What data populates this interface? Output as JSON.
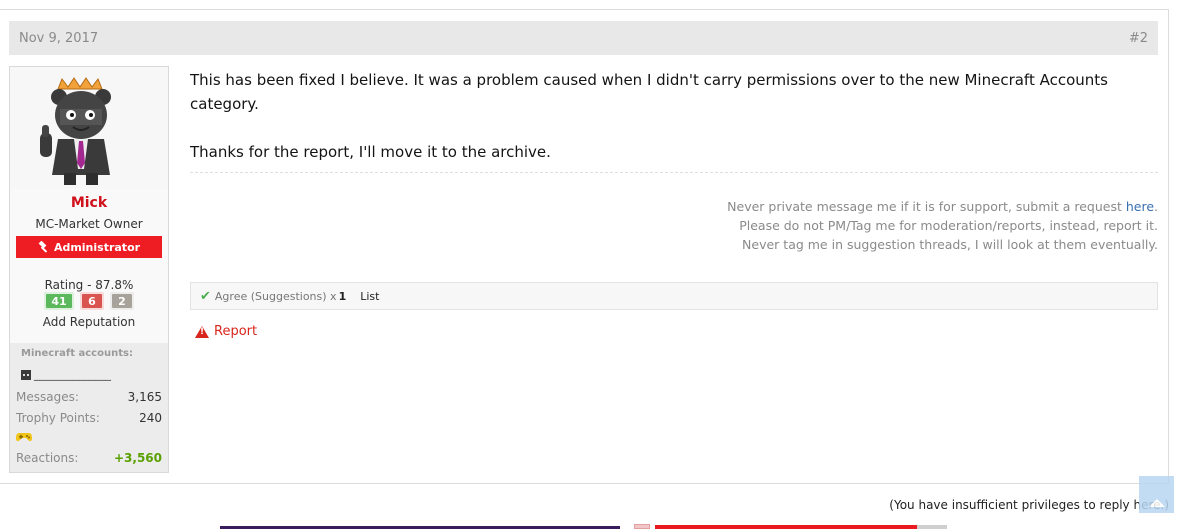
{
  "post": {
    "date": "Nov 9, 2017",
    "number": "#2",
    "paragraph1": "This has been fixed I believe. It was a problem caused when I didn't carry permissions over to the new Minecraft Accounts category.",
    "paragraph2": "Thanks for the report, I'll move it to the archive."
  },
  "user": {
    "name": "Mick",
    "title": "MC-Market Owner",
    "badge": "Administrator",
    "rating_label": "Rating - 87.8%",
    "rating_positive": "41",
    "rating_negative": "6",
    "rating_neutral": "2",
    "add_reputation": "Add Reputation",
    "minecraft_label": "Minecraft accounts:",
    "minecraft_name": "______________",
    "messages_label": "Messages:",
    "messages_value": "3,165",
    "trophy_label": "Trophy Points:",
    "trophy_value": "240",
    "reactions_label": "Reactions:",
    "reactions_value": "+3,560"
  },
  "signature": {
    "line1_prefix": "Never private message me if it is for support, submit a request ",
    "line1_link": "here",
    "line1_suffix": ".",
    "line2": "Please do not PM/Tag me for moderation/reports, instead, report it.",
    "line3": "Never tag me in suggestion threads, I will look at them eventually."
  },
  "reactions": {
    "label": "Agree",
    "category": "(Suggestions)",
    "multiplier": "x",
    "count": "1",
    "list": "List"
  },
  "actions": {
    "report": "Report"
  },
  "footer": {
    "reply_notice": "(You have insufficient privileges to reply here.)"
  },
  "icons": {
    "badge_icon": "hammer-icon",
    "report_icon": "warning-triangle-icon",
    "agree_icon": "checkmark-icon",
    "trophy_icon": "gamepad-icon",
    "scroll_icon": "arrow-up-icon"
  },
  "colors": {
    "username": "#d0101a",
    "admin_badge": "#ee1d23",
    "rating_positive": "#5cb85c",
    "rating_negative": "#d9534f",
    "rating_neutral": "#a7a39b",
    "reactions_positive": "#5aa000",
    "link": "#3a6fb0"
  }
}
